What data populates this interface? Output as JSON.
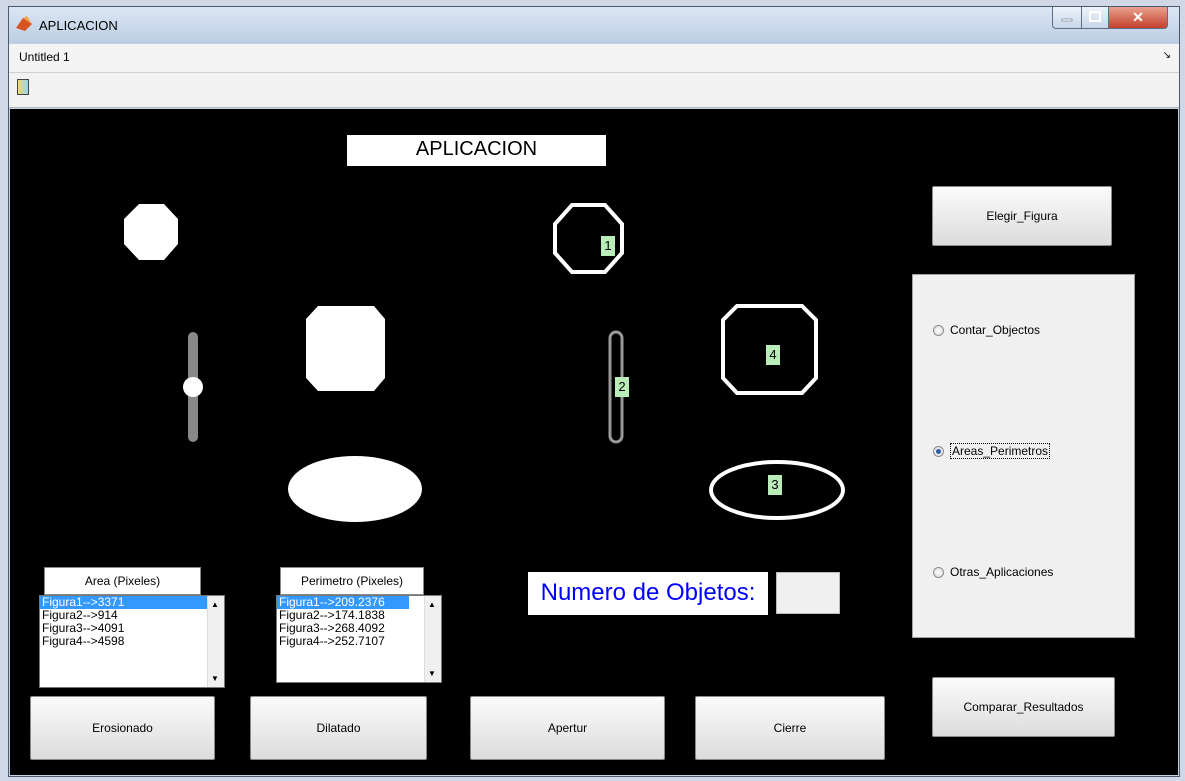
{
  "window": {
    "title": "APLICACION"
  },
  "menubar": {
    "document_name": "Untitled 1",
    "dock_arrow": "↘"
  },
  "toolbar": {
    "icon": "figure-icon"
  },
  "app": {
    "title": "APLICACION",
    "buttons": {
      "elegir": "Elegir_Figura",
      "comparar": "Comparar_Resultados",
      "erosionado": "Erosionado",
      "dilatado": "Dilatado",
      "apertur": "Apertur",
      "cierre": "Cierre"
    },
    "radios": [
      {
        "label": "Contar_Objectos",
        "selected": false
      },
      {
        "label": "Areas_Perimetros",
        "selected": true
      },
      {
        "label": "Otras_Aplicaciones",
        "selected": false
      }
    ],
    "area": {
      "header": "Area (Pixeles)",
      "items": [
        "Figura1-->3371",
        "Figura2-->914",
        "Figura3-->4091",
        "Figura4-->4598"
      ]
    },
    "perimetro": {
      "header": "Perimetro (Pixeles)",
      "items": [
        "Figura1-->209.2376",
        "Figura2-->174.1838",
        "Figura3-->268.4092",
        "Figura4-->252.7107"
      ]
    },
    "count": {
      "label": "Numero de Objetos:",
      "value": ""
    },
    "figure_labels": [
      "1",
      "2",
      "3",
      "4"
    ]
  }
}
